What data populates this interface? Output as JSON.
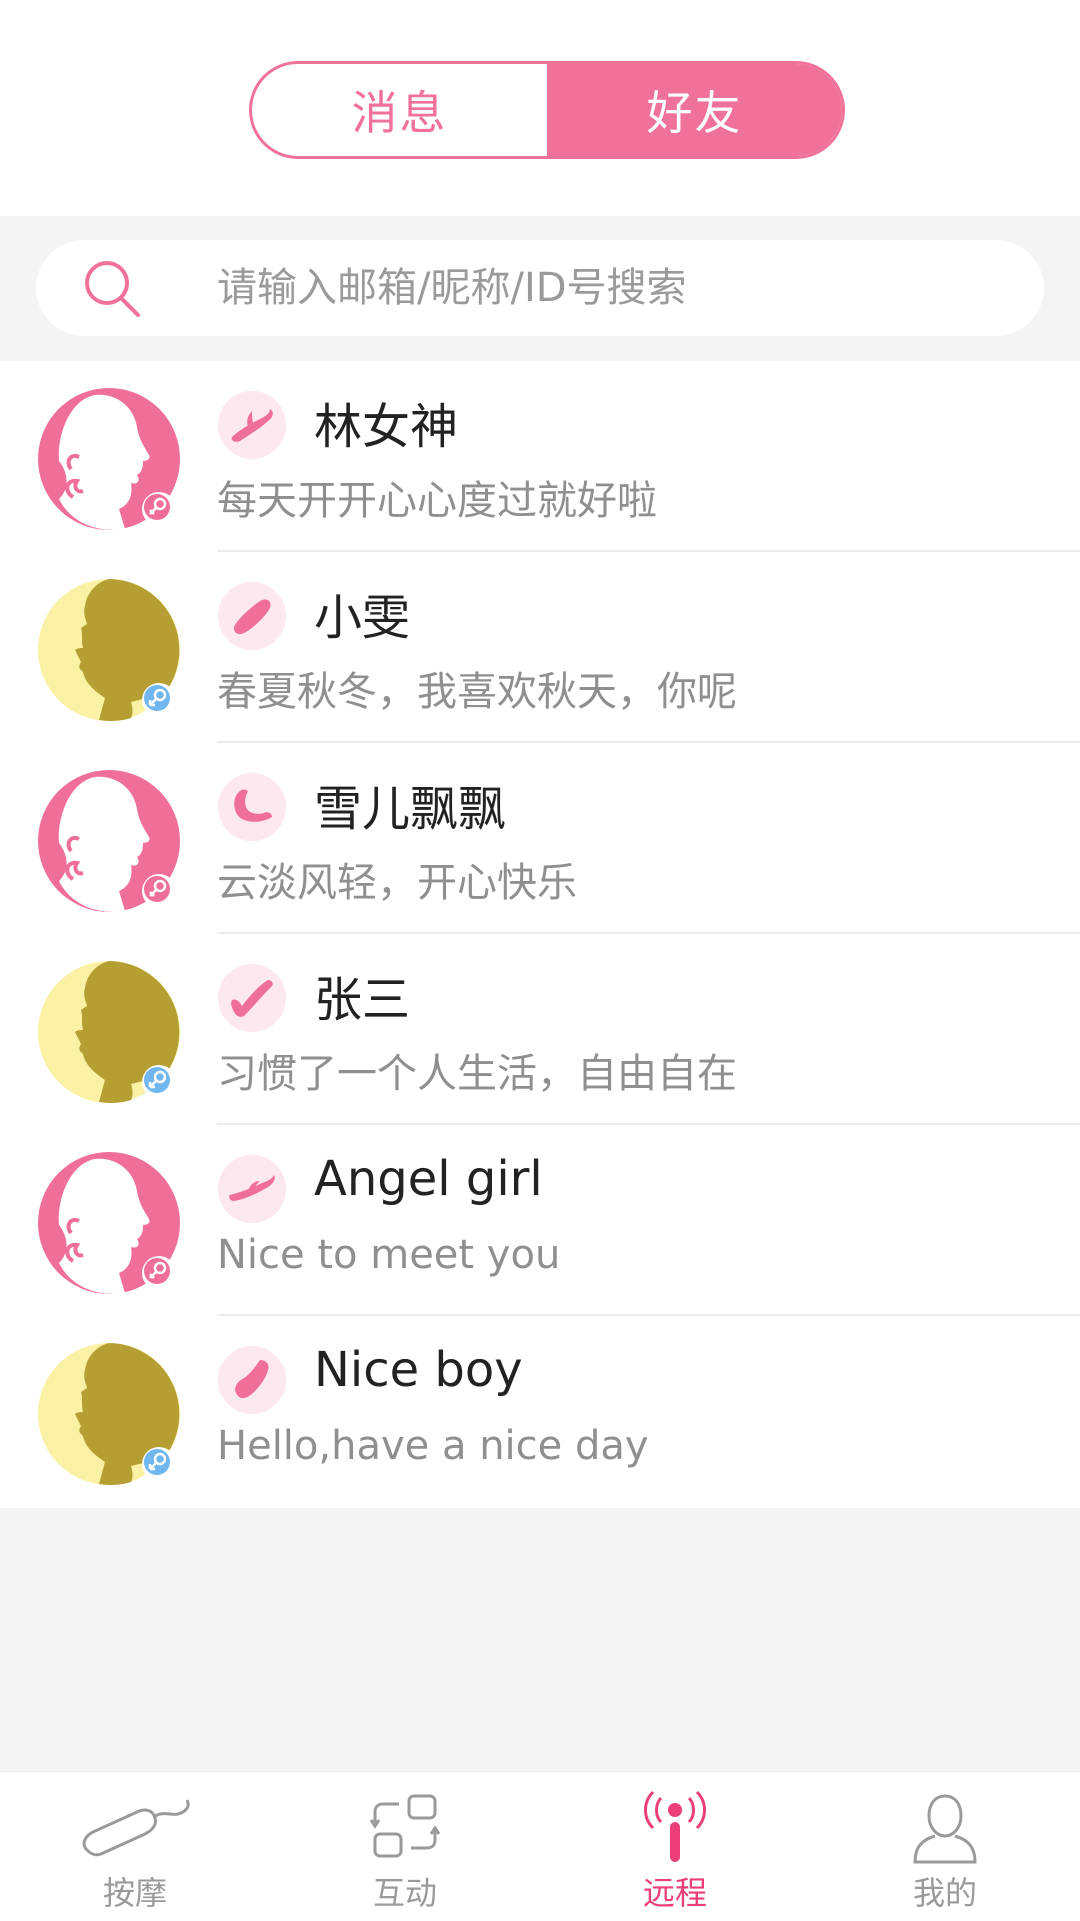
{
  "segment": {
    "tabs": [
      "消息",
      "好友"
    ],
    "active": 1
  },
  "search": {
    "placeholder": "请输入邮箱/昵称/ID号搜索",
    "value": ""
  },
  "friends": [
    {
      "name": "林女神",
      "signature": "每天开开心心度过就好啦",
      "gender": "female",
      "device": "rabbit-vibrator-icon"
    },
    {
      "name": "小雯",
      "signature": "春夏秋冬，我喜欢秋天，你呢",
      "gender": "male",
      "device": "bullet-vibrator-icon"
    },
    {
      "name": "雪儿飘飘",
      "signature": "云淡风轻，开心快乐",
      "gender": "female",
      "device": "curved-vibrator-icon"
    },
    {
      "name": "张三",
      "signature": "习惯了一个人生活，自由自在",
      "gender": "male",
      "device": "wand-vibrator-icon"
    },
    {
      "name": "Angel girl",
      "signature": "Nice to meet you",
      "gender": "female",
      "device": "rabbit-vibrator-icon"
    },
    {
      "name": "Nice boy",
      "signature": "Hello,have a nice day",
      "gender": "male",
      "device": "egg-vibrator-icon"
    }
  ],
  "tabbar": [
    {
      "label": "按摩",
      "icon": "massager-icon",
      "active": false
    },
    {
      "label": "互动",
      "icon": "interaction-icon",
      "active": false
    },
    {
      "label": "远程",
      "icon": "remote-signal-icon",
      "active": true
    },
    {
      "label": "我的",
      "icon": "profile-icon",
      "active": false
    }
  ],
  "colors": {
    "accent": "#f07299",
    "active_tab": "#ec3f7a",
    "female_avatar": "#ef6f98",
    "male_avatar_bg": "#fbf1a4",
    "male_avatar_fg": "#b59e32",
    "male_badge": "#6fb7ee"
  }
}
